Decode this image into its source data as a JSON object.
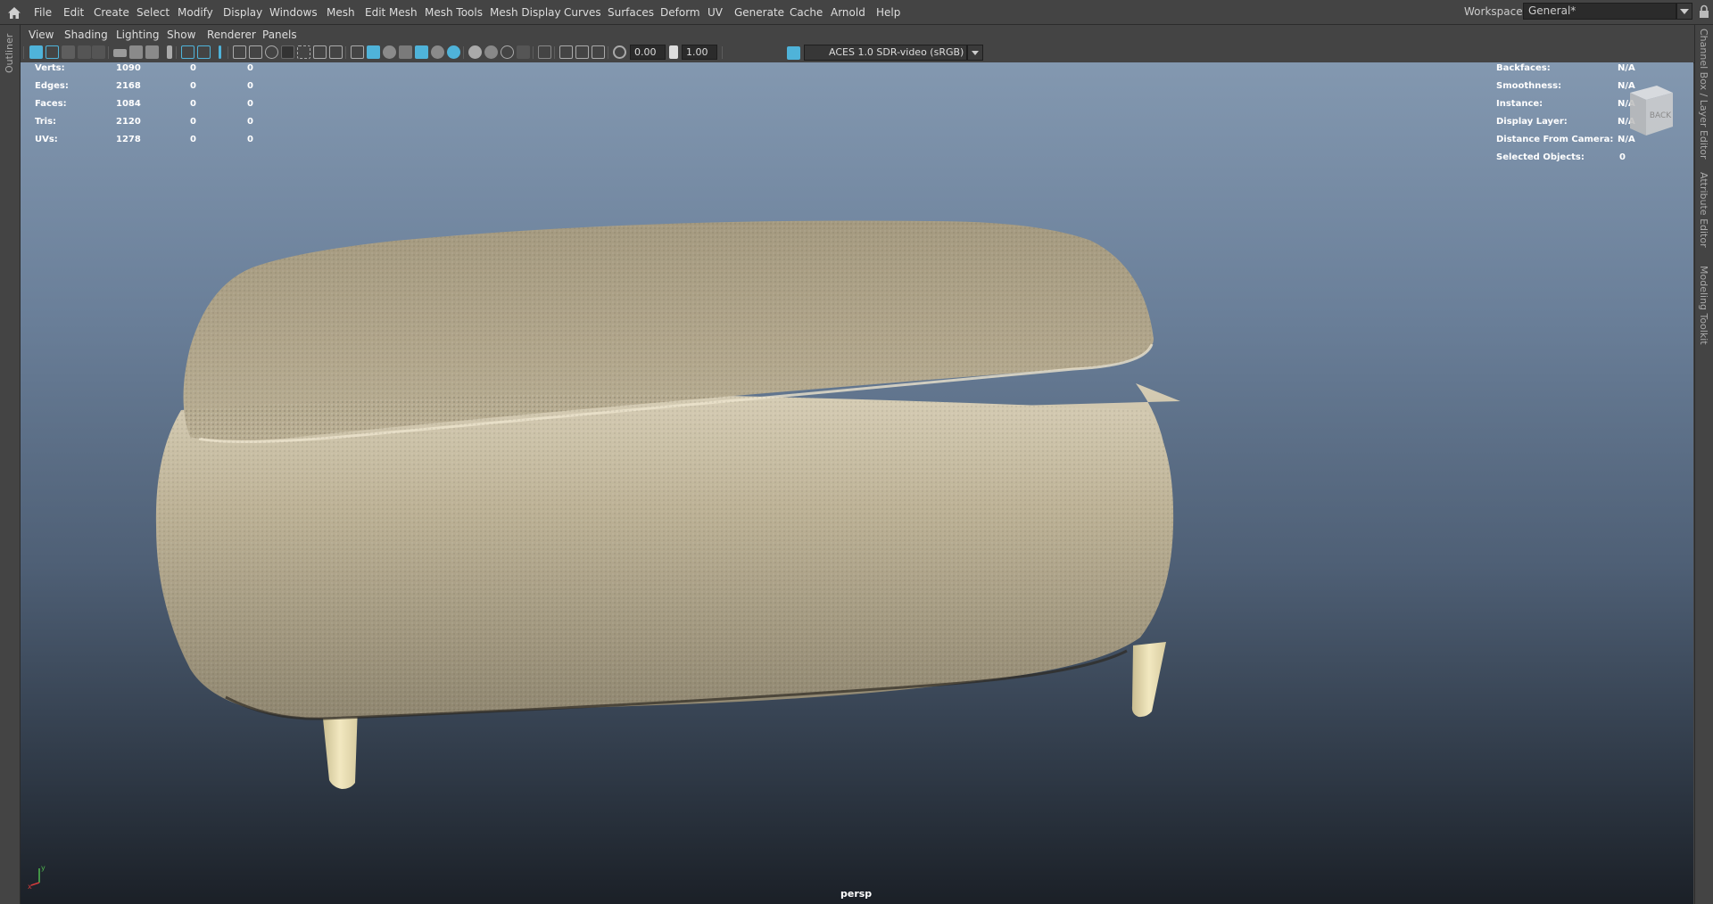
{
  "menubar": {
    "items": [
      "File",
      "Edit",
      "Create",
      "Select",
      "Modify",
      "Display",
      "Windows",
      "Mesh",
      "Edit Mesh",
      "Mesh Tools",
      "Mesh Display",
      "Curves",
      "Surfaces",
      "Deform",
      "UV",
      "Generate",
      "Cache",
      "Arnold",
      "Help"
    ],
    "workspace_label": "Workspace:",
    "workspace_value": "General*"
  },
  "left_tabs": [
    "Outliner"
  ],
  "right_tabs": [
    "Channel Box / Layer Editor",
    "Attribute Editor",
    "Modeling Toolkit"
  ],
  "panel_menu": [
    "View",
    "Shading",
    "Lighting",
    "Show",
    "Renderer",
    "Panels"
  ],
  "toolbar": {
    "exposure": "0.00",
    "gamma": "1.00",
    "color_space": "ACES 1.0 SDR-video (sRGB)",
    "accent_color": "#4fb3d9"
  },
  "hud_left": [
    {
      "label": "Verts:",
      "v1": "1090",
      "v2": "0",
      "v3": "0"
    },
    {
      "label": "Edges:",
      "v1": "2168",
      "v2": "0",
      "v3": "0"
    },
    {
      "label": "Faces:",
      "v1": "1084",
      "v2": "0",
      "v3": "0"
    },
    {
      "label": "Tris:",
      "v1": "2120",
      "v2": "0",
      "v3": "0"
    },
    {
      "label": "UVs:",
      "v1": "1278",
      "v2": "0",
      "v3": "0"
    }
  ],
  "hud_right": [
    {
      "label": "Backfaces:",
      "value": "N/A"
    },
    {
      "label": "Smoothness:",
      "value": "N/A"
    },
    {
      "label": "Instance:",
      "value": "N/A"
    },
    {
      "label": "Display Layer:",
      "value": "N/A"
    },
    {
      "label": "Distance From Camera:",
      "value": "N/A"
    },
    {
      "label": "Selected Objects:",
      "value": "0"
    }
  ],
  "viewcube_label": "BACK",
  "camera_label": "persp",
  "axis_labels": {
    "x": "x",
    "y": "y"
  },
  "colors": {
    "ottoman_fabric": "#b3a88e",
    "legs": "#e8dcb0"
  }
}
